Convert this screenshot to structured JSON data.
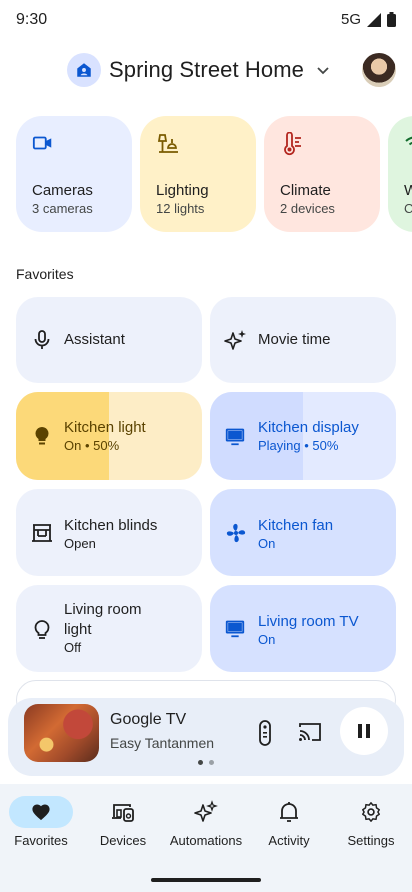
{
  "status_bar": {
    "time": "9:30",
    "network": "5G"
  },
  "header": {
    "home_name": "Spring Street Home",
    "home_icon": "home-icon",
    "avatar": "user-avatar"
  },
  "categories": [
    {
      "title": "Cameras",
      "subtitle": "3 cameras",
      "icon": "camera-icon",
      "color": "#e8eeff",
      "accent": "#0b57d0"
    },
    {
      "title": "Lighting",
      "subtitle": "12 lights",
      "icon": "lamp-icon",
      "color": "#fff1c8",
      "accent": "#7a5b00"
    },
    {
      "title": "Climate",
      "subtitle": "2 devices",
      "icon": "thermostat-icon",
      "color": "#ffe6df",
      "accent": "#b3261e"
    },
    {
      "title": "W",
      "subtitle": "C",
      "icon": "wifi-icon",
      "color": "#dff5df",
      "accent": "#146c2e"
    }
  ],
  "favorites": {
    "title": "Favorites",
    "tiles": [
      {
        "title": "Assistant",
        "subtitle": "",
        "icon": "microphone-icon"
      },
      {
        "title": "Movie time",
        "subtitle": "",
        "icon": "sparkle-icon"
      },
      {
        "title": "Kitchen light",
        "subtitle": "On • 50%",
        "icon": "lightbulb-icon",
        "level": 0.5
      },
      {
        "title": "Kitchen display",
        "subtitle": "Playing • 50%",
        "icon": "display-icon",
        "level": 0.5
      },
      {
        "title": "Kitchen blinds",
        "subtitle": "Open",
        "icon": "blinds-icon"
      },
      {
        "title": "Kitchen fan",
        "subtitle": "On",
        "icon": "fan-icon"
      },
      {
        "title": "Living room light",
        "subtitle": "Off",
        "icon": "lightbulb-outline-icon"
      },
      {
        "title": "Living room TV",
        "subtitle": "On",
        "icon": "tv-icon"
      }
    ]
  },
  "player": {
    "source": "Google TV",
    "title": "Easy Tantanmen",
    "pages": 2,
    "active_page": 1
  },
  "nav": {
    "items": [
      {
        "label": "Favorites",
        "icon": "heart-icon",
        "active": true
      },
      {
        "label": "Devices",
        "icon": "devices-icon",
        "active": false
      },
      {
        "label": "Automations",
        "icon": "automation-sparkle-icon",
        "active": false
      },
      {
        "label": "Activity",
        "icon": "bell-icon",
        "active": false
      },
      {
        "label": "Settings",
        "icon": "gear-icon",
        "active": false
      }
    ]
  }
}
